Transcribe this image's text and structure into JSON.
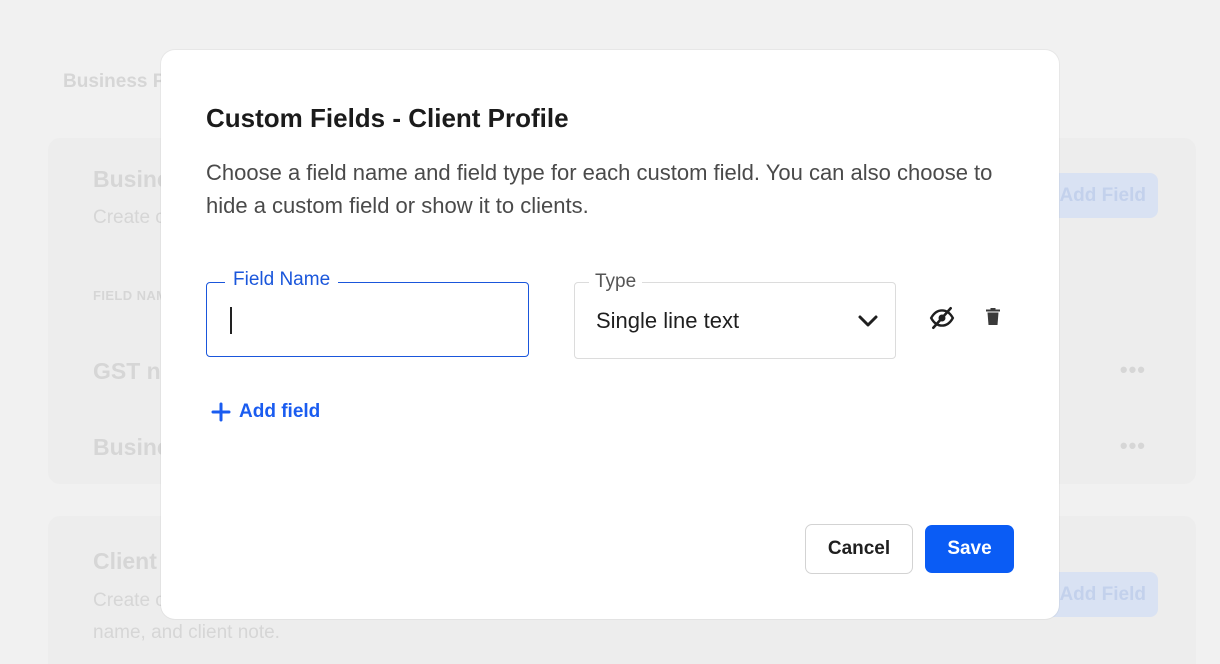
{
  "background": {
    "breadcrumb": "Business P",
    "card1": {
      "title": "Busine",
      "subtitle": "Create c",
      "column_header": "FIELD NAM",
      "add_button": "Add Field",
      "rows": [
        {
          "label": "GST nu"
        },
        {
          "label": "Busine"
        }
      ],
      "more_icon": "more-horizontal-icon"
    },
    "card2": {
      "title": "Client",
      "subtitle_line1": "Create c",
      "subtitle_line2": "name, and client note.",
      "add_button": "Add Field"
    }
  },
  "modal": {
    "title": "Custom Fields - Client Profile",
    "description": "Choose a field name and field type for each custom field. You can also choose to hide a custom field or show it to clients.",
    "field_name": {
      "label": "Field Name",
      "value": ""
    },
    "type": {
      "label": "Type",
      "value": "Single line text",
      "icon": "chevron-down-icon"
    },
    "hide_icon": "eye-off-icon",
    "delete_icon": "trash-icon",
    "add_field_label": "Add field",
    "cancel_label": "Cancel",
    "save_label": "Save",
    "colors": {
      "primary": "#0a5cf5",
      "focus": "#1a56db",
      "text": "#1b1b1b"
    }
  }
}
